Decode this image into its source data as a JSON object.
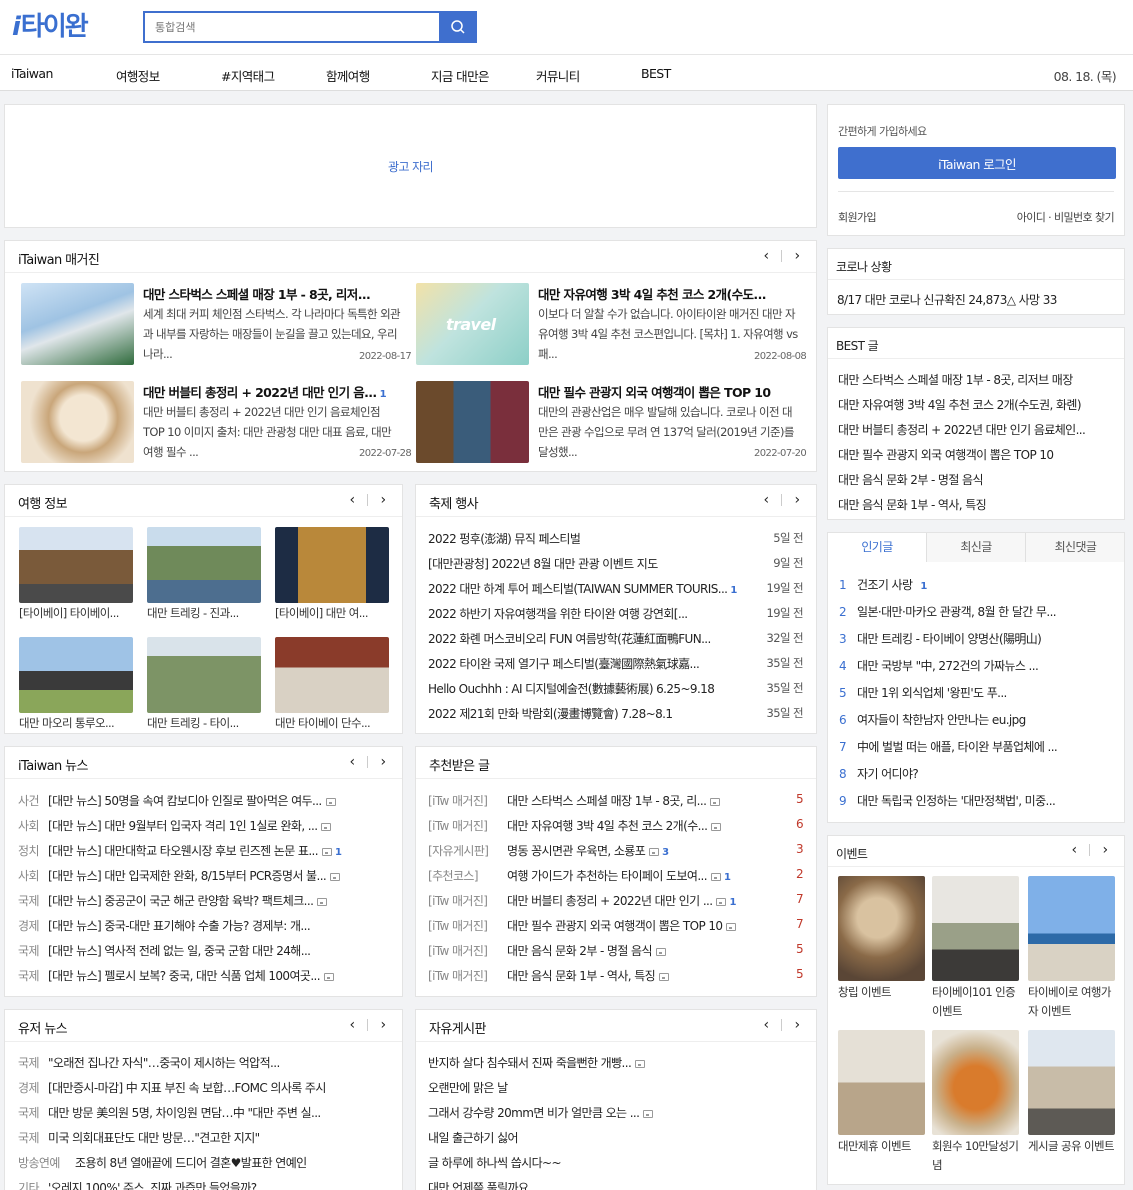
{
  "header": {
    "logo_mark": "i",
    "logo_text": "타이완",
    "search_placeholder": "통합검색"
  },
  "nav": {
    "items": [
      "iTaiwan",
      "여행정보",
      "#지역태그",
      "함께여행",
      "지금 대만은",
      "커뮤니티",
      "BEST"
    ],
    "date": "08. 18. (목)"
  },
  "ad": {
    "label": "광고 자리"
  },
  "magazine": {
    "title": "iTaiwan 매거진",
    "items": [
      {
        "title": "대만 스타벅스 스페셜 매장 1부 - 8곳, 리저...",
        "count": "",
        "desc": "세계 최대 커피 체인점 스타벅스. 각 나라마다 독특한 외관과 내부를 자랑하는 매장들이 눈길을 끌고 있는데요, 우리나라...",
        "date": "2022-08-17"
      },
      {
        "title": "대만 자유여행 3박 4일 추천 코스 2개(수도...",
        "count": "",
        "desc": "이보다 더 알찰 수가 없습니다. 아이타이완 매거진 대만 자유여행 3박 4일 추천 코스편입니다. [목차] 1. 자유여행 vs 패...",
        "date": "2022-08-08"
      },
      {
        "title": "대만 버블티 총정리 + 2022년 대만 인기 음...",
        "count": "1",
        "desc": "대만 버블티 총정리 + 2022년 대만 인기 음료체인점 TOP 10 이미지 출처: 대만 관광청 대만 대표 음료, 대만 여행 필수 ...",
        "date": "2022-07-28"
      },
      {
        "title": "대만 필수 관광지 외국 여행객이 뽑은 TOP 10",
        "count": "",
        "desc": "대만의 관광산업은 매우 발달해 있습니다. 코로나 이전 대만은 관광 수입으로 무려 연 137억 달러(2019년 기준)를 달성했...",
        "date": "2022-07-20"
      }
    ]
  },
  "travel_info": {
    "title": "여행 정보",
    "items": [
      "[타이베이] 타이베이...",
      "대만 트레킹 - 진과...",
      "[타이베이] 대만 여...",
      "대만 마오리 통루오...",
      "대만 트레킹 - 타이...",
      "대만 타이베이 단수..."
    ]
  },
  "festival": {
    "title": "축제 행사",
    "items": [
      {
        "text": "2022 펑후(澎湖) 뮤직 페스티벌",
        "count": "",
        "ago": "5일 전"
      },
      {
        "text": "[대만관광청] 2022년 8월 대만 관광 이벤트 지도",
        "count": "",
        "ago": "9일 전"
      },
      {
        "text": "2022 대만 하계 투어 페스티벌(TAIWAN SUMMER TOURIS...",
        "count": "1",
        "ago": "19일 전"
      },
      {
        "text": "2022 하반기 자유여행객을 위한 타이완 여행 강연회[...",
        "count": "",
        "ago": "19일 전"
      },
      {
        "text": "2022 화롄 머스코비오리 FUN 여름방학(花蓮紅面鴨FUN...",
        "count": "",
        "ago": "32일 전"
      },
      {
        "text": "2022 타이완 국제 열기구 페스티벌(臺灣國際熱氣球嘉...",
        "count": "",
        "ago": "35일 전"
      },
      {
        "text": "Hello Ouchhh : AI 디지털예술전(數據藝術展) 6.25~9.18",
        "count": "",
        "ago": "35일 전"
      },
      {
        "text": "2022 제21회 만화 박람회(漫畫博覽會) 7.28~8.1",
        "count": "",
        "ago": "35일 전"
      }
    ]
  },
  "news": {
    "title": "iTaiwan 뉴스",
    "items": [
      {
        "cat": "사건",
        "text": "[대만 뉴스] 50명을 속여 캄보디아 인질로 팔아먹은 여두...",
        "count": ""
      },
      {
        "cat": "사회",
        "text": "[대만 뉴스] 대만 9월부터 입국자 격리 1인 1실로 완화, ...",
        "count": ""
      },
      {
        "cat": "정치",
        "text": "[대만 뉴스] 대만대학교 타오웬시장 후보 린즈젠 논문 표...",
        "count": "1"
      },
      {
        "cat": "사회",
        "text": "[대만 뉴스] 대만 입국제한 완화, 8/15부터 PCR증명서 불...",
        "count": ""
      },
      {
        "cat": "국제",
        "text": "[대만 뉴스] 중공군이 국군 해군 란양함 육박? 팩트체크...",
        "count": ""
      },
      {
        "cat": "경제",
        "text": "[대만 뉴스] 중국-대만 표기해야 수출 가능? 경제부: 개...",
        "count": ""
      },
      {
        "cat": "국제",
        "text": "[대만 뉴스] 역사적 전례 없는 일, 중국 군함 대만 24해...",
        "count": ""
      },
      {
        "cat": "국제",
        "text": "[대만 뉴스] 펠로시 보복? 중국, 대만 식품 업체 100여곳...",
        "count": ""
      }
    ]
  },
  "recommended": {
    "title": "추천받은 글",
    "items": [
      {
        "cat": "[iTw 매거진]",
        "text": "대만 스타벅스 스페셜 매장 1부 - 8곳, 리...",
        "count": "",
        "num": "5"
      },
      {
        "cat": "[iTw 매거진]",
        "text": "대만 자유여행 3박 4일 추천 코스 2개(수...",
        "count": "",
        "num": "6"
      },
      {
        "cat": "[자유게시판]",
        "text": "명동 꽁시면관 우육면, 소룡포",
        "count": "3",
        "num": "3"
      },
      {
        "cat": "[추천코스]",
        "text": "여행 가이드가 추천하는 타이페이 도보여...",
        "count": "1",
        "num": "2"
      },
      {
        "cat": "[iTw 매거진]",
        "text": "대만 버블티 총정리 + 2022년 대만 인기 ...",
        "count": "1",
        "num": "7"
      },
      {
        "cat": "[iTw 매거진]",
        "text": "대만 필수 관광지 외국 여행객이 뽑은 TOP 10",
        "count": "",
        "num": "7"
      },
      {
        "cat": "[iTw 매거진]",
        "text": "대만 음식 문화 2부 - 명절 음식",
        "count": "",
        "num": "5"
      },
      {
        "cat": "[iTw 매거진]",
        "text": "대만 음식 문화 1부 - 역사, 특징",
        "count": "",
        "num": "5"
      }
    ]
  },
  "user_news": {
    "title": "유저 뉴스",
    "items": [
      {
        "cat": "국제",
        "text": "\"오래전 집나간 자식\"…중국이 제시하는 억압적..."
      },
      {
        "cat": "경제",
        "text": "[대만증시-마감] 中 지표 부진 속 보합…FOMC 의사록 주시"
      },
      {
        "cat": "국제",
        "text": "대만 방문 美의원 5명, 차이잉원 면담…中 \"대만 주변 실..."
      },
      {
        "cat": "국제",
        "text": "미국 의회대표단도 대만 방문…\"견고한 지지\""
      },
      {
        "cat": "방송연예",
        "text": "조용히 8년 열애끝에 드디어 결혼♥발표한 연예인"
      },
      {
        "cat": "기타",
        "text": "'오레지 100%' 주스, 진짜 과즙만 들었을까?"
      }
    ]
  },
  "free_board": {
    "title": "자유게시판",
    "items": [
      {
        "text": "반지하 살다 침수돼서 진짜 죽을뻔한 개빵...",
        "img": true
      },
      {
        "text": "오랜만에 맑은 날",
        "img": false
      },
      {
        "text": "그래서 강수량 20mm면 비가 얼만큼 오는 ...",
        "img": true
      },
      {
        "text": "내일 출근하기 싫어",
        "img": false
      },
      {
        "text": "글 하루에 하나씩 씁시다~~",
        "img": false
      },
      {
        "text": "대만 언제쯤 풀릴까요",
        "img": false
      }
    ]
  },
  "login": {
    "hint": "간편하게 가입하세요",
    "button": "iTaiwan 로그인",
    "join": "회원가입",
    "find": "아이디 · 비밀번호 찾기"
  },
  "corona": {
    "title": "코로나 상황",
    "text": "8/17 대만 코로나 신규확진 24,873△ 사망 33"
  },
  "best": {
    "title": "BEST 글",
    "items": [
      "대만 스타벅스 스페셜 매장 1부 - 8곳, 리저브 매장",
      "대만 자유여행 3박 4일 추천 코스 2개(수도권, 화롄)",
      "대만 버블티 총정리 + 2022년 대만 인기 음료체인...",
      "대만 필수 관광지 외국 여행객이 뽑은 TOP 10",
      "대만 음식 문화 2부 - 명절 음식",
      "대만 음식 문화 1부 - 역사, 특징"
    ]
  },
  "ranking": {
    "tabs": [
      "인기글",
      "최신글",
      "최신댓글"
    ],
    "items": [
      {
        "num": "1",
        "text": "건조기 사랑",
        "count": "1"
      },
      {
        "num": "2",
        "text": "일본·대만·마카오 관광객, 8월 한 달간 무...",
        "count": ""
      },
      {
        "num": "3",
        "text": "대만 트레킹 - 타이베이 양명산(陽明山)",
        "count": ""
      },
      {
        "num": "4",
        "text": "대만 국방부 \"中, 272건의 가짜뉴스 ...",
        "count": ""
      },
      {
        "num": "5",
        "text": "대만 1위 외식업체 '왕핀'도 푸...",
        "count": ""
      },
      {
        "num": "6",
        "text": "여자들이 착한남자 안만나는 eu.jpg",
        "count": ""
      },
      {
        "num": "7",
        "text": "中에 벌벌 떠는 애플, 타이완 부품업체에 ...",
        "count": ""
      },
      {
        "num": "8",
        "text": "자기 어디야?",
        "count": ""
      },
      {
        "num": "9",
        "text": "대만 독립국 인정하는 '대만정책법', 미중...",
        "count": ""
      }
    ]
  },
  "events": {
    "title": "이벤트",
    "items": [
      "창립 이벤트",
      "타이베이101 인증이벤트",
      "타이베이로 여행가자 이벤트",
      "대만제휴 이벤트",
      "회원수 10만달성기념",
      "게시글 공유 이벤트"
    ]
  },
  "colors": {
    "accent": "#3f6fce",
    "red": "#c0392b"
  }
}
